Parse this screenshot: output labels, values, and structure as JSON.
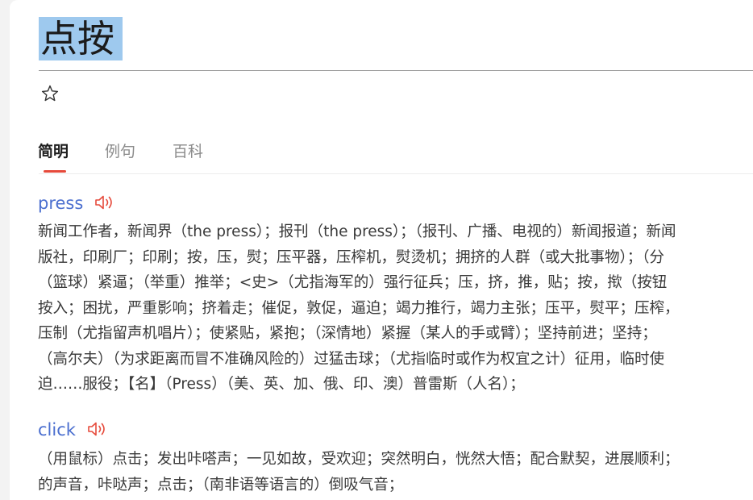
{
  "headword": "点按",
  "icons": {
    "favorite": "star-outline-icon",
    "audio": "speaker-icon"
  },
  "tabs": [
    {
      "label": "简明",
      "active": true
    },
    {
      "label": "例句",
      "active": false
    },
    {
      "label": "百科",
      "active": false
    }
  ],
  "entries": [
    {
      "word": "press",
      "definition_lines": [
        "新闻工作者，新闻界（the press）；报刊（the press）；（报刊、广播、电视的）新闻报道；新闻",
        "版社，印刷厂；印刷；按，压，熨；压平器，压榨机，熨烫机；拥挤的人群（或大批事物）；（分",
        "（篮球）紧逼；（举重）推举；<史>（尤指海军的）强行征兵；压，挤，推，贴；按，揿（按钮",
        "按入；困扰，严重影响；挤着走；催促，敦促，逼迫；竭力推行，竭力主张；压平，熨平；压榨，",
        "压制（尤指留声机唱片）；使紧贴，紧抱；（深情地）紧握（某人的手或臂）；坚持前进；坚持；",
        "（高尔夫）（为求距离而冒不准确风险的）过猛击球；（尤指临时或作为权宜之计）征用，临时使",
        "迫……服役；【名】（Press）（美、英、加、俄、印、澳）普雷斯（人名）；"
      ]
    },
    {
      "word": "click",
      "definition_lines": [
        "（用鼠标）点击；发出咔嗒声；一见如故，受欢迎；突然明白，恍然大悟；配合默契，进展顺利；",
        "的声音，咔哒声；点击；（南非语等语言的）倒吸气音；"
      ]
    }
  ],
  "colors": {
    "accent_red": "#e64a3b",
    "link_blue": "#4b6fcf",
    "selection": "#9ec9ee"
  }
}
